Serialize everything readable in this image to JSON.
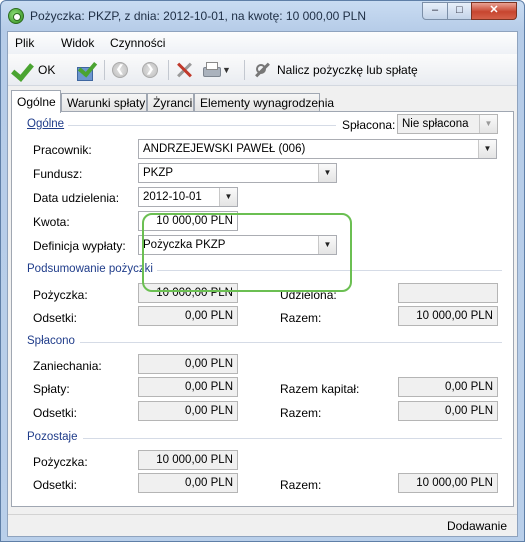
{
  "window": {
    "title": "Pożyczka: PKZP, z dnia: 2012-10-01, na kwotę: 10 000,00 PLN",
    "minimize": "–",
    "maximize": "□",
    "close": "✕"
  },
  "menu": {
    "plik": "Plik",
    "widok": "Widok",
    "czynnosci": "Czynności"
  },
  "toolbar": {
    "ok_label": "OK",
    "nalicz_label": "Nalicz pożyczkę lub spłatę",
    "back_glyph": "❮",
    "forward_glyph": "❯",
    "dropdown_glyph": "▼",
    "icons": [
      "check-icon",
      "save-check-icon",
      "back-icon",
      "forward-icon",
      "tools-icon",
      "print-icon",
      "calculate-icon"
    ]
  },
  "tabs": [
    "Ogólne",
    "Warunki spłaty",
    "Żyranci",
    "Elementy wynagrodzenia"
  ],
  "general": {
    "section_title": "Ogólne",
    "splacona_label": "Spłacona:",
    "splacona_value": "Nie spłacona",
    "pracownik_label": "Pracownik:",
    "pracownik_value": "ANDRZEJEWSKI PAWEŁ (006)",
    "fundusz_label": "Fundusz:",
    "fundusz_value": "PKZP",
    "data_label": "Data udzielenia:",
    "data_value": "2012-10-01",
    "kwota_label": "Kwota:",
    "kwota_value": "10 000,00 PLN",
    "definicja_label": "Definicja wypłaty:",
    "definicja_value": "Pożyczka PKZP"
  },
  "podsumowanie": {
    "title": "Podsumowanie pożyczki",
    "pozyczka_label": "Pożyczka:",
    "pozyczka_value": "10 000,00 PLN",
    "udzielona_label": "Udzielona:",
    "udzielona_value": "",
    "odsetki_label": "Odsetki:",
    "odsetki_value": "0,00 PLN",
    "razem_label": "Razem:",
    "razem_value": "10 000,00 PLN"
  },
  "splacono": {
    "title": "Spłacono",
    "zaniechania_label": "Zaniechania:",
    "zaniechania_value": "0,00 PLN",
    "splaty_label": "Spłaty:",
    "splaty_value": "0,00 PLN",
    "razem_kapital_label": "Razem kapitał:",
    "razem_kapital_value": "0,00 PLN",
    "odsetki_label": "Odsetki:",
    "odsetki_value": "0,00 PLN",
    "razem_label": "Razem:",
    "razem_value": "0,00 PLN"
  },
  "pozostaje": {
    "title": "Pozostaje",
    "pozyczka_label": "Pożyczka:",
    "pozyczka_value": "10 000,00 PLN",
    "odsetki_label": "Odsetki:",
    "odsetki_value": "0,00 PLN",
    "razem_label": "Razem:",
    "razem_value": "10 000,00 PLN"
  },
  "status": "Dodawanie"
}
